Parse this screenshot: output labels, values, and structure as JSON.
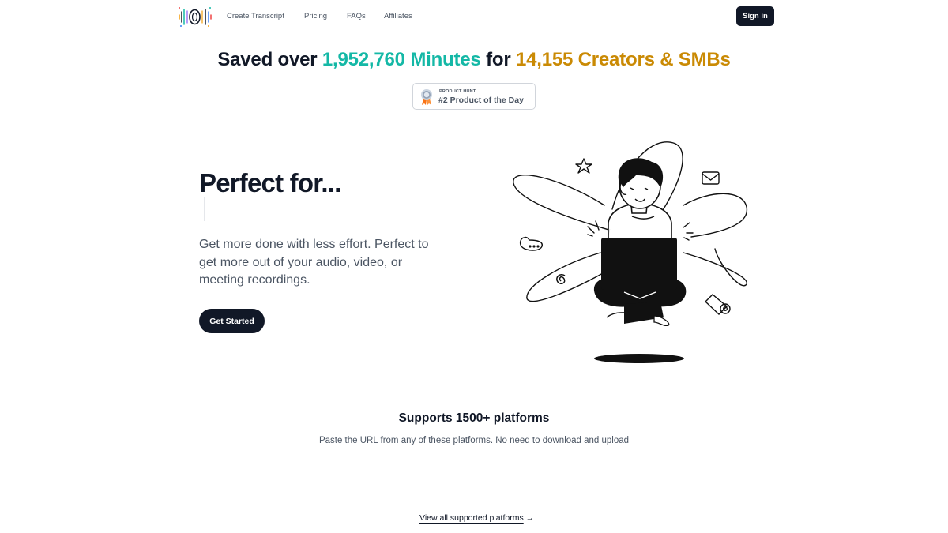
{
  "nav": {
    "links": [
      "Create Transcript",
      "Pricing",
      "FAQs",
      "Affiliates"
    ],
    "signin_label": "Sign in"
  },
  "headline": {
    "prefix": "Saved over",
    "minutes_count": "1,952,760",
    "minutes_word": "Minutes",
    "mid": "for",
    "creators_count": "14,155",
    "creators_word": "Creators & SMBs"
  },
  "badge": {
    "small": "PRODUCT HUNT",
    "big": "#2 Product of the Day"
  },
  "hero": {
    "title": "Perfect for...",
    "description": "Get more done with less effort. Perfect to get more out of your audio, video, or meeting recordings.",
    "cta_label": "Get Started"
  },
  "platforms": {
    "title": "Supports 1500+ platforms",
    "subtitle": "Paste the URL from any of these platforms. No need to download and upload",
    "view_all_label": "View all supported platforms",
    "view_all_arrow": "→"
  },
  "colors": {
    "accent_teal": "#14b8a6",
    "accent_gold": "#ca8a04",
    "dark": "#111827"
  },
  "icons": [
    "logo-icon",
    "medal-icon",
    "star-icon",
    "mail-icon",
    "chat-bubble-icon",
    "swirl-icon",
    "at-letter-icon"
  ]
}
